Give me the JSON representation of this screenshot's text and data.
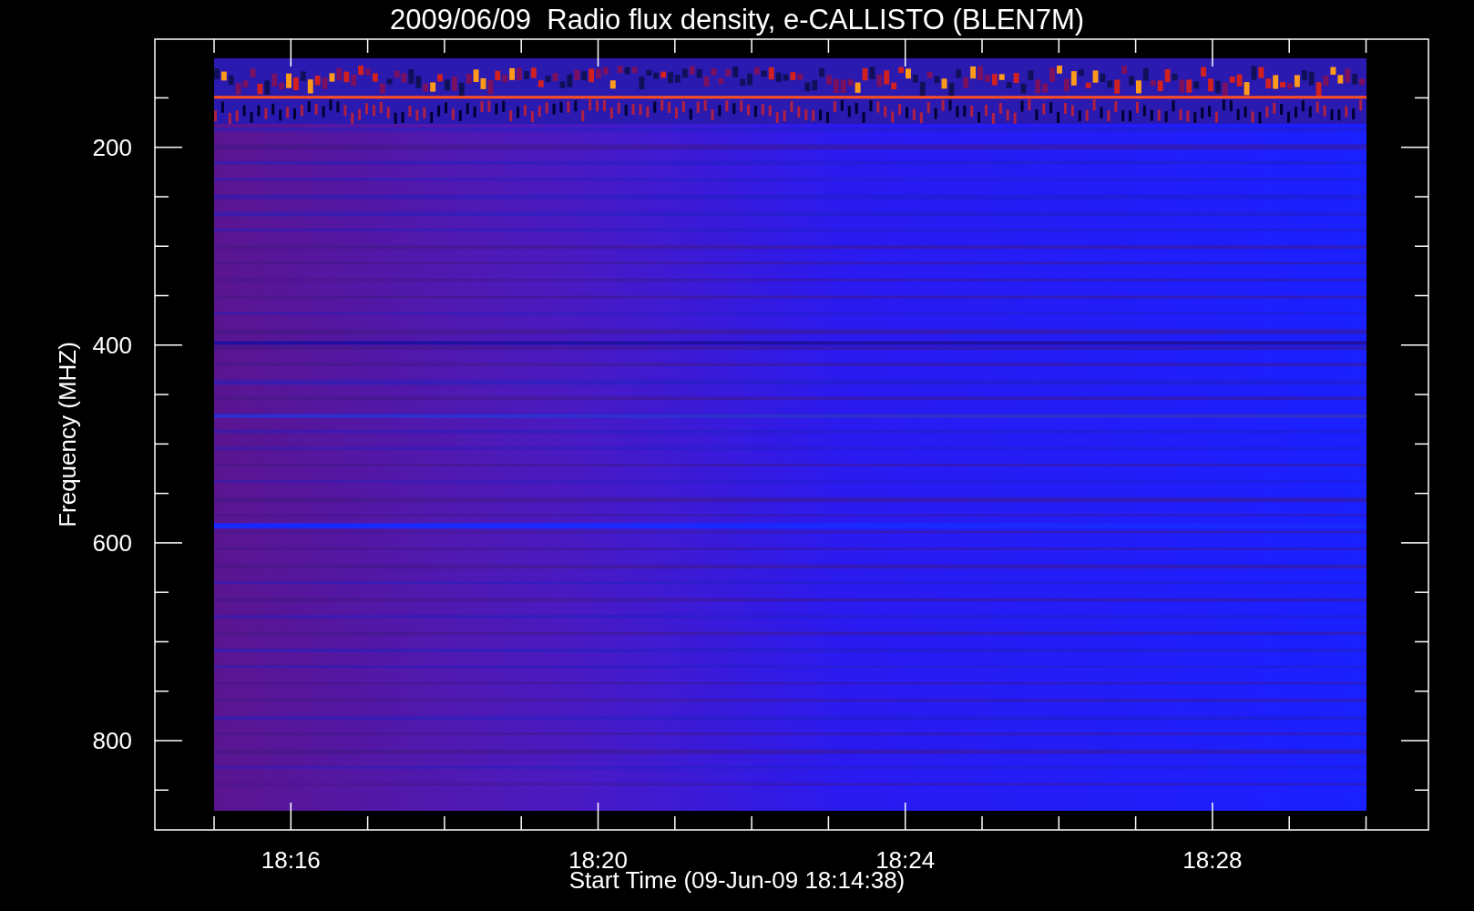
{
  "title": "2009/06/09  Radio flux density, e-CALLISTO (BLEN7M)",
  "y_axis": {
    "label": "Frequency (MHZ)",
    "ticks": [
      "200",
      "400",
      "600",
      "800"
    ]
  },
  "x_axis": {
    "label": "Start Time (09-Jun-09 18:14:38)",
    "ticks": [
      "18:16",
      "18:20",
      "18:24",
      "18:28"
    ]
  }
}
